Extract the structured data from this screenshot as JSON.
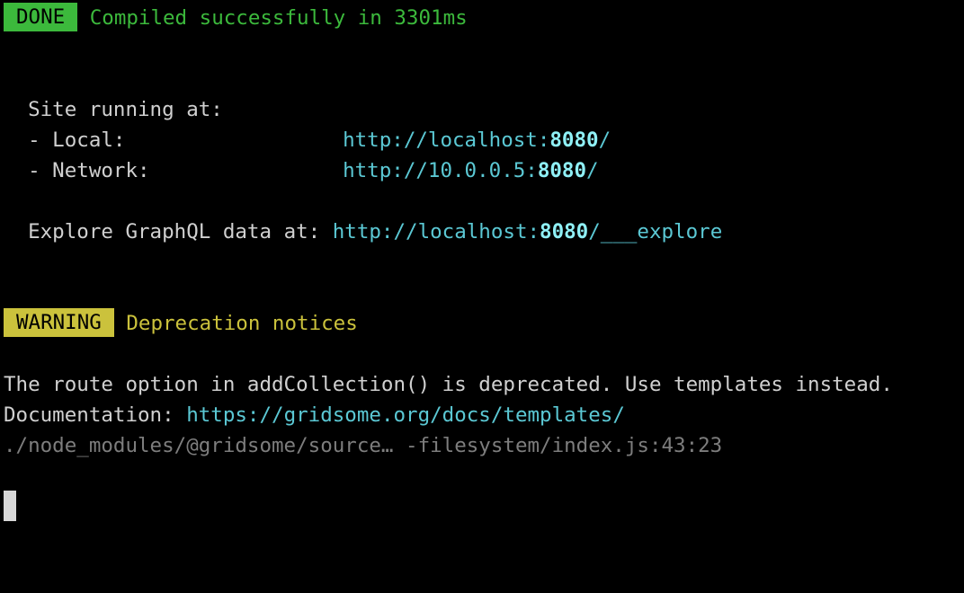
{
  "done": {
    "badge": "DONE",
    "message": "Compiled successfully in 3301ms"
  },
  "site": {
    "heading": "Site running at:",
    "local_label": "- Local:",
    "local_url_prefix": "http://localhost:",
    "local_port": "8080",
    "local_url_suffix": "/",
    "network_label": "- Network:",
    "network_url_prefix": "http://10.0.0.5:",
    "network_port": "8080",
    "network_url_suffix": "/",
    "explore_label": "Explore GraphQL data at:",
    "explore_url_prefix": "http://localhost:",
    "explore_port": "8080",
    "explore_url_suffix": "/___explore"
  },
  "warning": {
    "badge": "WARNING",
    "message": "Deprecation notices",
    "notice": "The route option in addCollection() is deprecated. Use templates instead.",
    "doc_label": "Documentation:",
    "doc_url": "https://gridsome.org/docs/templates/",
    "trace": "./node_modules/@gridsome/source… -filesystem/index.js:43:23"
  },
  "colors": {
    "background": "#000000",
    "text": "#d0d0d0",
    "success": "#3cb93c",
    "warning": "#cbc23c",
    "link": "#5bc8d4",
    "port": "#8ff0f6",
    "dim": "#7d7d7d"
  }
}
